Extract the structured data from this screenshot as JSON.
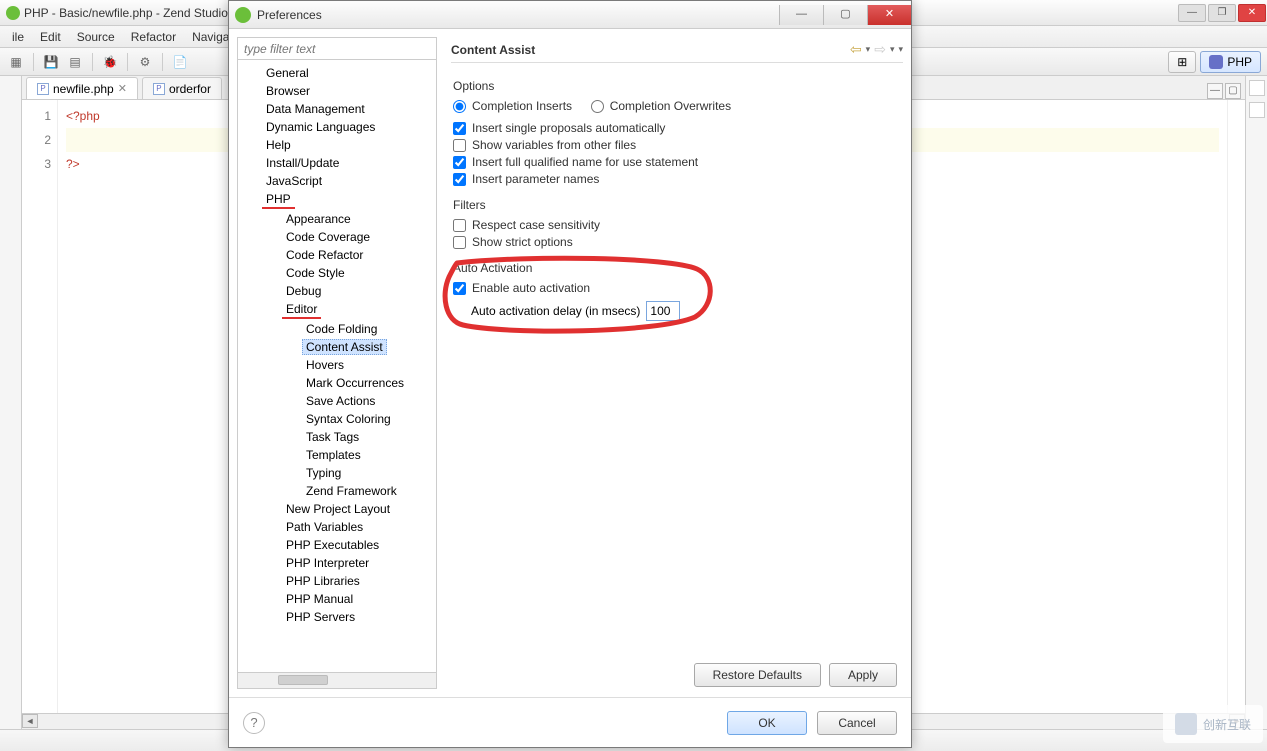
{
  "ide": {
    "title": "PHP - Basic/newfile.php - Zend Studio",
    "menus": [
      "ile",
      "Edit",
      "Source",
      "Refactor",
      "Naviga"
    ],
    "tabs": [
      {
        "label": "newfile.php",
        "icon": "P",
        "active": true,
        "dirty": false
      },
      {
        "label": "orderfor",
        "icon": "P",
        "active": false,
        "dirty": false
      }
    ],
    "code": {
      "lines": [
        "<?php",
        "",
        "?>"
      ]
    },
    "perspective": {
      "label": "PHP"
    }
  },
  "pref": {
    "title": "Preferences",
    "filter_placeholder": "type filter text",
    "tree": {
      "l1": [
        "General",
        "Browser",
        "Data Management",
        "Dynamic Languages",
        "Help",
        "Install/Update",
        "JavaScript",
        "PHP"
      ],
      "php_children": [
        "Appearance",
        "Code Coverage",
        "Code Refactor",
        "Code Style",
        "Debug",
        "Editor"
      ],
      "editor_children": [
        "Code Folding",
        "Content Assist",
        "Hovers",
        "Mark Occurrences",
        "Save Actions",
        "Syntax Coloring",
        "Task Tags",
        "Templates",
        "Typing",
        "Zend Framework"
      ],
      "php_after_editor": [
        "New Project Layout",
        "Path Variables",
        "PHP Executables",
        "PHP Interpreter",
        "PHP Libraries",
        "PHP Manual",
        "PHP Servers"
      ],
      "selected": "Content Assist"
    },
    "page": {
      "title": "Content Assist",
      "sections": {
        "options_label": "Options",
        "radio_inserts": "Completion Inserts",
        "radio_overwrites": "Completion Overwrites",
        "cb_single": "Insert single proposals automatically",
        "cb_vars": "Show variables from other files",
        "cb_fqn": "Insert full qualified name for use statement",
        "cb_params": "Insert parameter names",
        "filters_label": "Filters",
        "cb_case": "Respect case sensitivity",
        "cb_strict": "Show strict options",
        "auto_label": "Auto Activation",
        "cb_enable_auto": "Enable auto activation",
        "delay_label": "Auto activation delay (in msecs)",
        "delay_value": "100"
      },
      "state": {
        "radio": "inserts",
        "cb_single": true,
        "cb_vars": false,
        "cb_fqn": true,
        "cb_params": true,
        "cb_case": false,
        "cb_strict": false,
        "cb_enable_auto": true
      },
      "buttons": {
        "restore": "Restore Defaults",
        "apply": "Apply",
        "ok": "OK",
        "cancel": "Cancel"
      }
    }
  },
  "watermark": {
    "text": "创新互联"
  }
}
